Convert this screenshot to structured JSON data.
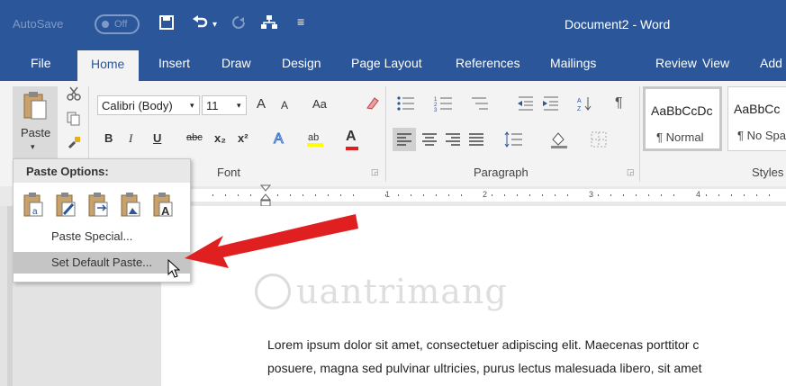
{
  "titlebar": {
    "autosave_label": "AutoSave",
    "autosave_state": "Off",
    "doc_title": "Document2  -  Word",
    "quick_access": [
      "save-icon",
      "undo-icon",
      "redo-icon",
      "touch-mode-icon",
      "customize-icon"
    ]
  },
  "tabs": [
    "File",
    "Home",
    "Insert",
    "Draw",
    "Design",
    "Page Layout",
    "References",
    "Mailings",
    "Review",
    "View",
    "Add"
  ],
  "ribbon": {
    "clipboard": {
      "paste_label": "Paste"
    },
    "font": {
      "group_label": "Font",
      "font_name": "Calibri (Body)",
      "font_size": "11",
      "change_case": "Aa",
      "bold": "B",
      "italic": "I",
      "underline": "U",
      "strike": "abc",
      "subscript": "x₂",
      "superscript": "x²",
      "grow": "A",
      "shrink": "A",
      "font_color": "A"
    },
    "paragraph": {
      "group_label": "Paragraph",
      "pilcrow": "¶"
    },
    "styles": {
      "group_label": "Styles",
      "items": [
        {
          "sample": "AaBbCcDc",
          "name": "¶ Normal"
        },
        {
          "sample": "AaBbCc",
          "name": "¶ No Spa"
        }
      ]
    }
  },
  "ruler": {
    "numbers": [
      "1",
      "2",
      "3",
      "4"
    ]
  },
  "paste_menu": {
    "header": "Paste Options:",
    "options": [
      "keep-source-formatting-icon",
      "merge-formatting-icon",
      "picture-icon",
      "keep-text-only-icon",
      "text-only-icon"
    ],
    "items": [
      "Paste Special...",
      "Set Default Paste..."
    ]
  },
  "watermark": {
    "text": "uantrimang"
  },
  "document": {
    "lines": [
      "Lorem ipsum dolor sit amet, consectetuer adipiscing elit. Maecenas porttitor c",
      "posuere, magna sed pulvinar ultricies, purus lectus malesuada libero, sit amet"
    ]
  },
  "colors": {
    "accent": "#2b579a",
    "arrow": "#e02020",
    "ribbon_bg": "#f3f3f3"
  }
}
